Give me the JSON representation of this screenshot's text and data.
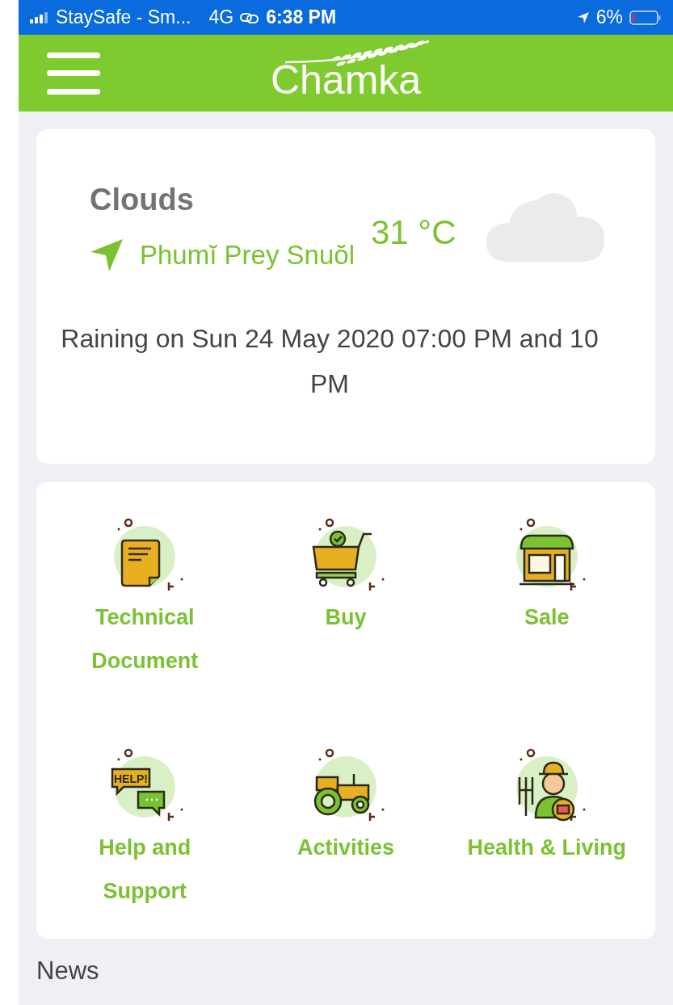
{
  "status_bar": {
    "carrier": "StaySafe - Sm...",
    "network": "4G",
    "time": "6:38 PM",
    "battery": "6%"
  },
  "header": {
    "logo": "Chamka"
  },
  "weather": {
    "condition": "Clouds",
    "temperature": "31 °C",
    "location": "Phumĭ Prey Snuŏl",
    "forecast": "Raining on Sun 24 May 2020 07:00 PM and 10 PM"
  },
  "menu": [
    {
      "label": "Technical Document",
      "kind": "document"
    },
    {
      "label": "Buy",
      "kind": "cart"
    },
    {
      "label": "Sale",
      "kind": "shop"
    },
    {
      "label": "Help and Support",
      "kind": "help",
      "icon_text": "HELP!"
    },
    {
      "label": "Activities",
      "kind": "tractor"
    },
    {
      "label": "Health & Living",
      "kind": "farmer"
    }
  ],
  "news": {
    "title": "News"
  }
}
